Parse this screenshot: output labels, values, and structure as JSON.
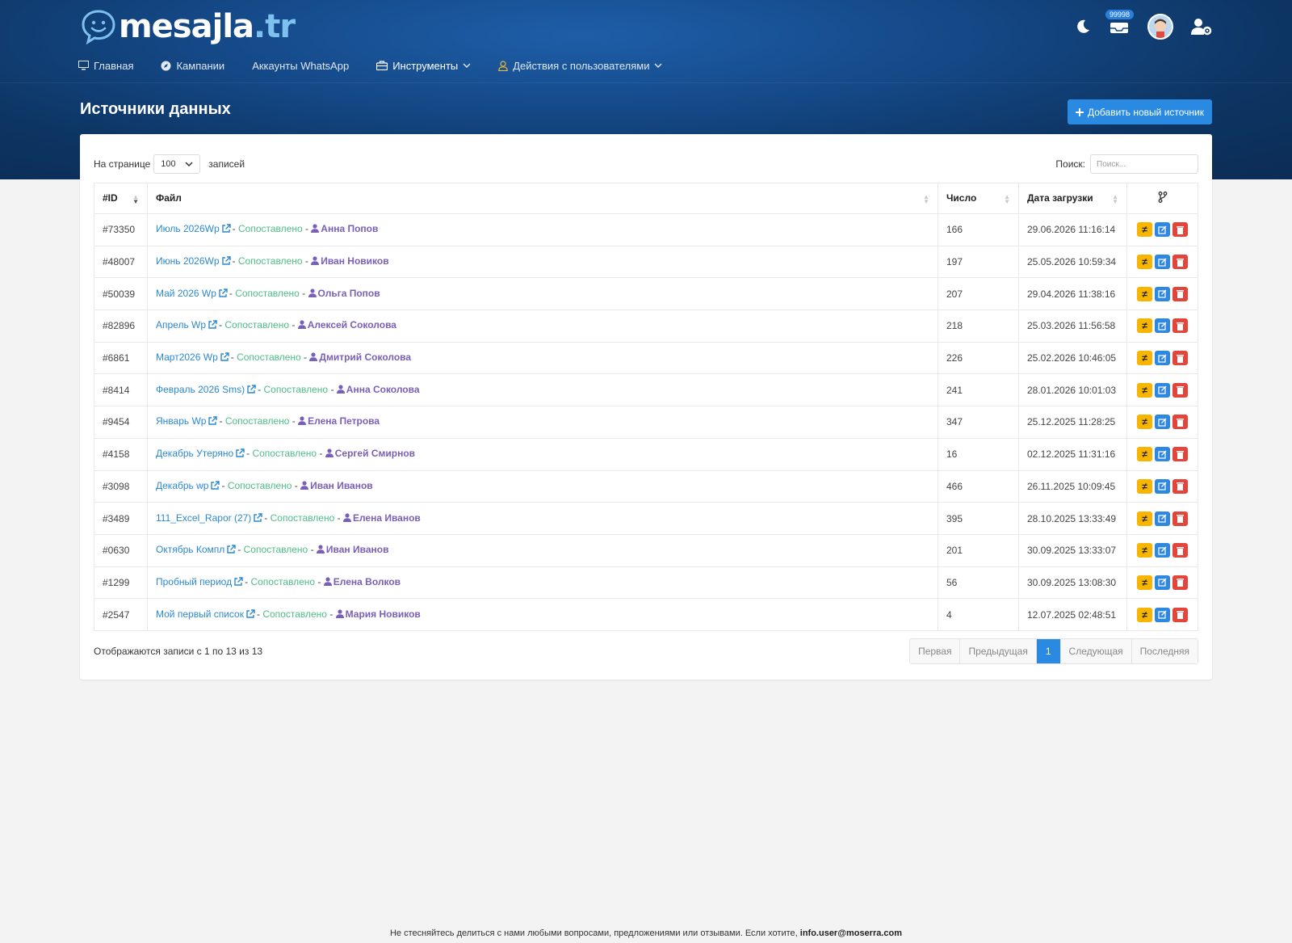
{
  "brand": {
    "name": "mesajla",
    "tld": ".tr"
  },
  "header": {
    "inbox_badge": "99998"
  },
  "nav": {
    "home": "Главная",
    "campaigns": "Кампании",
    "whatsapp": "Аккаунты WhatsApp",
    "tools": "Инструменты",
    "user_actions": "Действия с пользователями"
  },
  "page": {
    "title": "Источники данных",
    "add_button": "Добавить новый источник"
  },
  "controls": {
    "per_page_label": "На странице",
    "per_page_value": "100",
    "records_label": "записей",
    "search_label": "Поиск:",
    "search_placeholder": "Поиск..."
  },
  "table": {
    "headers": {
      "id": "#ID",
      "file": "Файл",
      "count": "Число",
      "date": "Дата загрузки"
    },
    "rows": [
      {
        "id": "#73350",
        "file": "Июль 2026Wp",
        "status": "Сопоставлено",
        "user": "Анна Попов",
        "count": "166",
        "date": "29.06.2026 11:16:14"
      },
      {
        "id": "#48007",
        "file": "Июнь 2026Wp",
        "status": "Сопоставлено",
        "user": "Иван Новиков",
        "count": "197",
        "date": "25.05.2026 10:59:34"
      },
      {
        "id": "#50039",
        "file": "Май 2026 Wp",
        "status": "Сопоставлено",
        "user": "Ольга Попов",
        "count": "207",
        "date": "29.04.2026 11:38:16"
      },
      {
        "id": "#82896",
        "file": "Апрель Wp",
        "status": "Сопоставлено",
        "user": "Алексей Соколова",
        "count": "218",
        "date": "25.03.2026 11:56:58"
      },
      {
        "id": "#6861",
        "file": "Март2026 Wp",
        "status": "Сопоставлено",
        "user": "Дмитрий Соколова",
        "count": "226",
        "date": "25.02.2026 10:46:05"
      },
      {
        "id": "#8414",
        "file": "Февраль 2026 Sms)",
        "status": "Сопоставлено",
        "user": "Анна Соколова",
        "count": "241",
        "date": "28.01.2026 10:01:03"
      },
      {
        "id": "#9454",
        "file": "Январь Wp",
        "status": "Сопоставлено",
        "user": "Елена Петрова",
        "count": "347",
        "date": "25.12.2025 11:28:25"
      },
      {
        "id": "#4158",
        "file": "Декабрь Утеряно",
        "status": "Сопоставлено",
        "user": "Сергей Смирнов",
        "count": "16",
        "date": "02.12.2025 11:31:16"
      },
      {
        "id": "#3098",
        "file": "Декабрь wp",
        "status": "Сопоставлено",
        "user": "Иван Иванов",
        "count": "466",
        "date": "26.11.2025 10:09:45"
      },
      {
        "id": "#3489",
        "file": "111_Excel_Rapor (27)",
        "status": "Сопоставлено",
        "user": "Елена Иванов",
        "count": "395",
        "date": "28.10.2025 13:33:49"
      },
      {
        "id": "#0630",
        "file": "Октябрь Компл",
        "status": "Сопоставлено",
        "user": "Иван Иванов",
        "count": "201",
        "date": "30.09.2025 13:33:07"
      },
      {
        "id": "#1299",
        "file": "Пробный период",
        "status": "Сопоставлено",
        "user": "Елена Волков",
        "count": "56",
        "date": "30.09.2025 13:08:30"
      },
      {
        "id": "#2547",
        "file": "Мой первый список",
        "status": "Сопоставлено",
        "user": "Мария Новиков",
        "count": "4",
        "date": "12.07.2025 02:48:51"
      }
    ]
  },
  "pagination": {
    "info": "Отображаются записи с 1 по 13 из 13",
    "first": "Первая",
    "prev": "Предыдущая",
    "current": "1",
    "next": "Следующая",
    "last": "Последняя"
  },
  "footer": {
    "message": "Не стесняйтесь делиться с нами любыми вопросами, предложениями или отзывами. Если хотите,",
    "email": "info.user@moserra.com"
  },
  "colors": {
    "accent": "#2a89e0",
    "link": "#2b89d0",
    "status": "#4fbd88",
    "user": "#7a5fb8",
    "warning": "#f7b500",
    "danger": "#e4453a"
  }
}
